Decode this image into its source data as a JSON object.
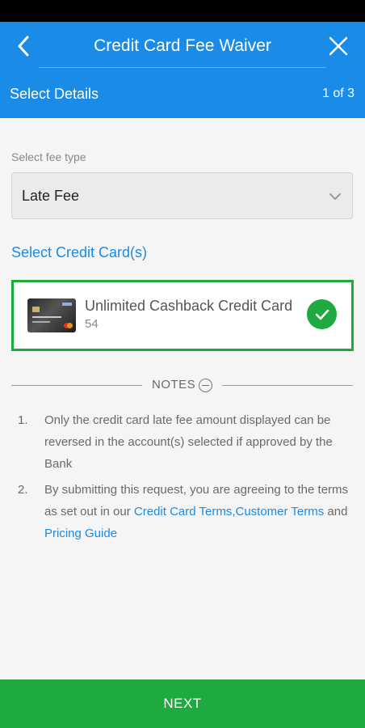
{
  "header": {
    "title": "Credit Card Fee Waiver",
    "step_label": "Select Details",
    "step_count": "1 of 3"
  },
  "fee_type": {
    "label": "Select fee type",
    "value": "Late Fee"
  },
  "cards_section": {
    "title": "Select Credit Card(s)",
    "cards": [
      {
        "name": "Unlimited Cashback Credit Card",
        "digits": "54",
        "selected": true
      }
    ]
  },
  "notes": {
    "label": "NOTES",
    "items": [
      {
        "index": "1.",
        "text": "Only the credit card late fee amount displayed can be reversed in the account(s) selected if approved by the Bank"
      },
      {
        "index": "2.",
        "text_before": "By submitting this request, you are agreeing to the terms as set out in our ",
        "link_1": "Credit Card Terms",
        "separator": ",",
        "link_2": "Customer Terms",
        "middle": " and ",
        "link_3": "Pricing Guide"
      }
    ]
  },
  "footer": {
    "next_label": "NEXT"
  },
  "colors": {
    "primary_blue": "#1a8be6",
    "success_green": "#1faa3f"
  }
}
